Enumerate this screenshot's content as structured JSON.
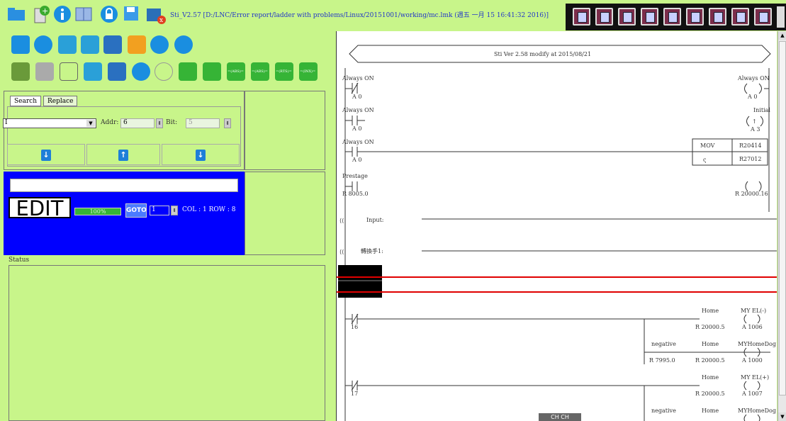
{
  "title": {
    "text": "Sti_V2.57 [D:/LNC/Error report/ladder with problems/Linux/20151001/working/mc.lmk (週五 一月 15 16:41:32 2016)]"
  },
  "colors": {
    "panel_bg": "#c8f58a",
    "edit_bg": "#0000ff",
    "ladder_bg": "#ffffff",
    "selection_highlight": "#e00000",
    "progress": "#36b436"
  },
  "top_toolbar_icons": [
    "folder-icon",
    "new-file-icon",
    "info-icon",
    "book-icon",
    "lock-icon",
    "save-icon",
    "close-file-icon"
  ],
  "right_toolbar_icons": [
    "view1-icon",
    "view2-icon",
    "view3-icon",
    "view4-icon",
    "view5-icon",
    "view6-icon",
    "view7-icon",
    "view8-icon",
    "view9-icon"
  ],
  "toolbar_row2": [
    "import-icon",
    "monitor-icon",
    "notes-icon",
    "list-icon",
    "eye-icon",
    "network-icon",
    "pencil-icon",
    "padlock-icon"
  ],
  "toolbar_row3": [
    "copy-icon",
    "paste-icon",
    "cut-icon",
    "delete-row-icon",
    "delete-icon",
    "undo-icon",
    "redo-icon",
    "insert-row-icon",
    "insert-col-icon"
  ],
  "toolbar_row3_labels": [
    "=(ABS)=",
    "=(ABS)=",
    "=(RTS)=",
    "=(INX)="
  ],
  "search": {
    "tabs": [
      "Search",
      "Replace"
    ],
    "type_value": "I",
    "addr_label": "Addr:",
    "addr_value": "6",
    "bit_label": "Bit:",
    "bit_value": "5"
  },
  "edit": {
    "mode_label": "EDIT",
    "progress_percent": 100,
    "progress_text": "100%",
    "goto_label": "GOTO",
    "goto_value": "1",
    "col_row_text": "COL : 1 ROW : 8"
  },
  "status": {
    "label": "Status"
  },
  "ladder": {
    "header_text": "Sti Ver 2.58 modify at 2015/08/21",
    "rungs": [
      {
        "left_label": "Always ON",
        "left_addr": "A 0",
        "right_label": "Always ON",
        "right_addr": "A 0"
      },
      {
        "left_label": "Always ON",
        "left_addr": "A 0",
        "right_label": "Initial",
        "right_addr": "A 3"
      },
      {
        "left_label": "Always ON",
        "left_addr": "A 0",
        "func": "MOV",
        "func_a": "R20414",
        "func_b": "R27012"
      },
      {
        "left_label": "Prestage",
        "left_addr": "R 8005.0",
        "right_addr": "R 20000.16"
      }
    ],
    "comments": [
      "Input:",
      "轉換手1:"
    ],
    "home_blocks": [
      {
        "contact_addr": "16",
        "home_label": "Home",
        "home_addr": "R 20000.5",
        "out_label": "MY EL(-)",
        "out_addr": "A 1006",
        "neg_label": "negative",
        "neg_addr": "R 7995.0",
        "home2_label": "Home",
        "home2_addr": "R 20000.5",
        "out2_label": "MYHomeDog",
        "out2_addr": "A 1000"
      },
      {
        "contact_addr": "17",
        "home_label": "Home",
        "home_addr": "R 20000.5",
        "out_label": "MY EL(+)",
        "out_addr": "A 1007",
        "neg_label": "negative",
        "home2_label": "Home",
        "out2_label": "MYHomeDog"
      }
    ],
    "bottom_badge": "CH CH"
  }
}
